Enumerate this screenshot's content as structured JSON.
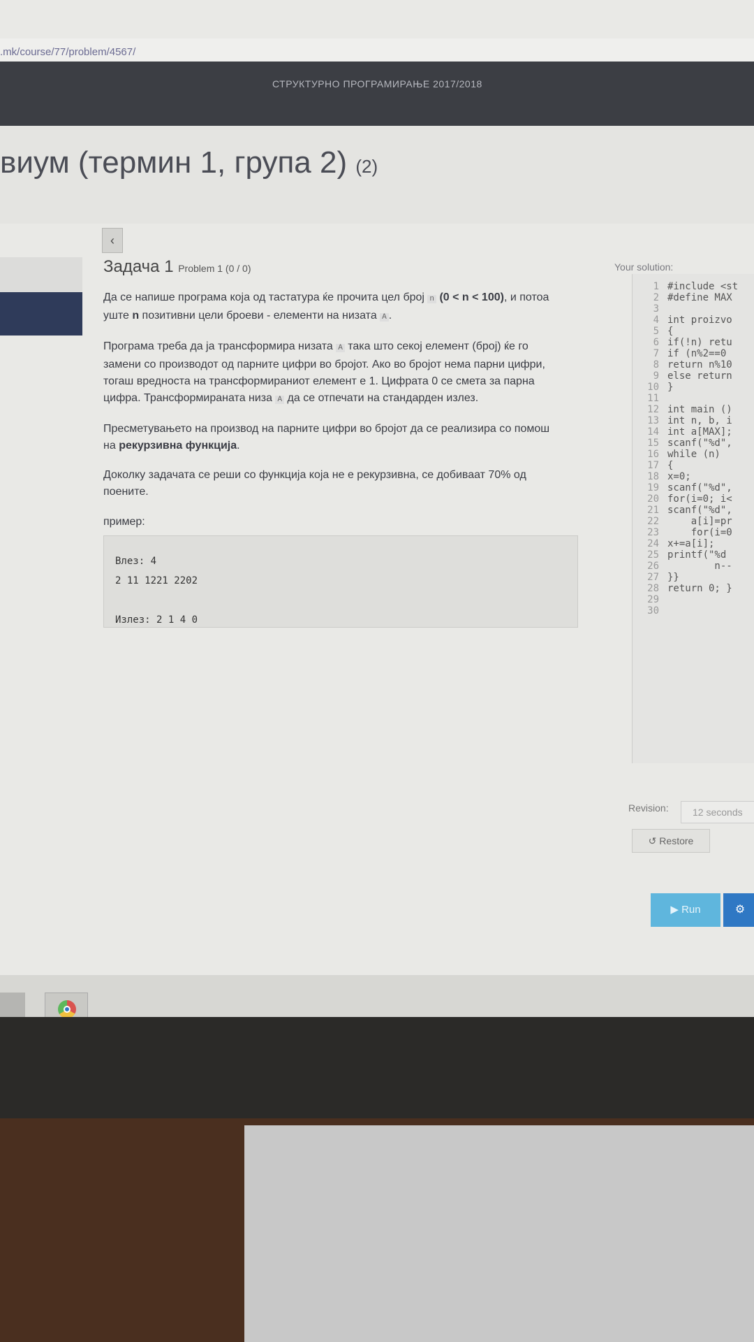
{
  "browser": {
    "url": ".mk/course/77/problem/4567/"
  },
  "course": {
    "title": "СТРУКТУРНО ПРОГРАМИРАЊЕ 2017/2018"
  },
  "exam": {
    "title": "виум (термин 1, група 2)",
    "count": "(2)"
  },
  "problem": {
    "title": "Задача 1",
    "subtitle": "Problem 1 (0 / 0)",
    "p1a": "Да се напише програма која од тастатура ќе прочита цел број ",
    "var_n": "n",
    "p1b": " (0 < n < 100)",
    "p1c": ", и потоа уште ",
    "p1d": "n",
    "p1e": " позитивни цели броеви - елементи на низата ",
    "var_A": "A",
    "p1f": ".",
    "p2a": "Програма треба да ја трансформира низата ",
    "p2b": " така што секој елемент (број) ќе го замени со производот од парните цифри во бројот. Ако во бројот нема парни цифри, тогаш вредноста на трансформираниот елемент е 1. Цифрата 0 се смета за парна цифра. Трансформираната низа ",
    "p2c": " да се отпечати на стандарден излез.",
    "p3a": "Пресметувањето на производ на парните цифри во бројот да се реализира со помош на ",
    "p3b": "рекурзивна функција",
    "p3c": ".",
    "p4": "Доколку задачата се реши со функција која не е рекурзивна, се добиваат 70% од поените.",
    "example_label": "пример:",
    "example_input_label": "Влез:  4",
    "example_input_line2": "2 11 1221 2202",
    "example_output": "Излез: 2 1 4 0"
  },
  "solution": {
    "label": "Your solution:",
    "lines": [
      "#include <st",
      "#define MAX",
      "",
      "int proizvo",
      "{",
      "if(!n) retu",
      "if (n%2==0",
      "return n%10",
      "else return",
      "}",
      "",
      "int main ()",
      "int n, b, i",
      "int a[MAX];",
      "scanf(\"%d\",",
      "while (n)",
      "{",
      "x=0;",
      "scanf(\"%d\",",
      "for(i=0; i<",
      "scanf(\"%d\",",
      "    a[i]=pr",
      "    for(i=0",
      "x+=a[i];",
      "printf(\"%d",
      "        n--",
      "}}",
      "return 0; }",
      "",
      ""
    ]
  },
  "revision": {
    "label": "Revision:",
    "value": "12 seconds"
  },
  "buttons": {
    "restore": "Restore",
    "run": "▶ Run",
    "submit": "⚙"
  },
  "colors": {
    "navbar": "#3c3e44",
    "run": "#5fb6dd",
    "submit": "#2f78c4"
  }
}
